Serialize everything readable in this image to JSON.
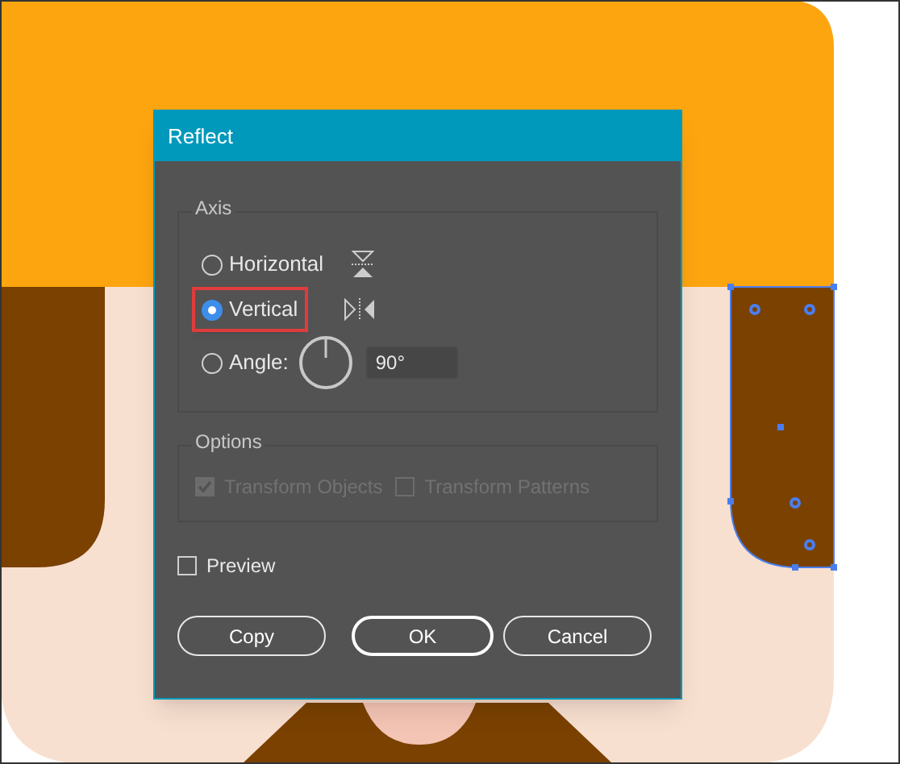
{
  "dialog": {
    "title": "Reflect",
    "axis": {
      "label": "Axis",
      "options": [
        {
          "label": "Horizontal",
          "selected": false,
          "highlighted": false,
          "kind": "horizontal"
        },
        {
          "label": "Vertical",
          "selected": true,
          "highlighted": true,
          "kind": "vertical"
        },
        {
          "label": "Angle:",
          "selected": false,
          "highlighted": false,
          "kind": "angle"
        }
      ],
      "angle": {
        "value": "90°"
      }
    },
    "options": {
      "label": "Options",
      "checkboxes": [
        {
          "label": "Transform Objects",
          "checked": true,
          "disabled": true
        },
        {
          "label": "Transform Patterns",
          "checked": false,
          "disabled": true
        }
      ]
    },
    "preview": {
      "label": "Preview",
      "checked": false
    },
    "buttons": [
      {
        "label": "Copy",
        "default": false
      },
      {
        "label": "OK",
        "default": true
      },
      {
        "label": "Cancel",
        "default": false
      }
    ]
  }
}
